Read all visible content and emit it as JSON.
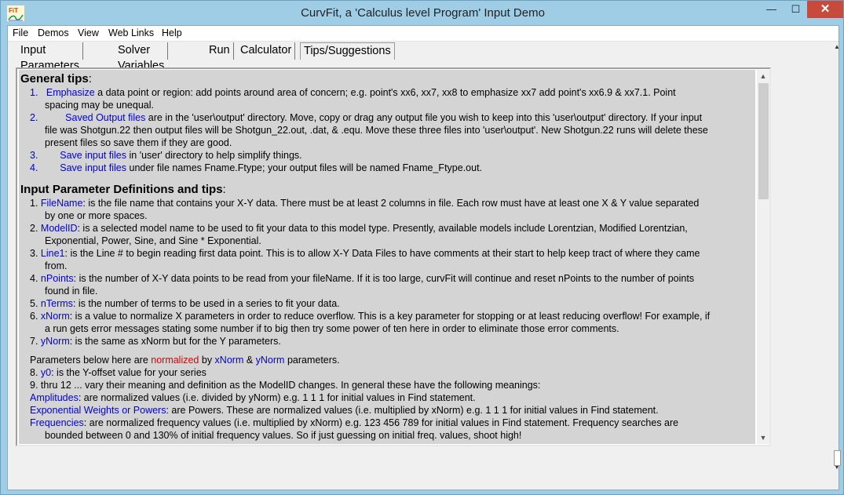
{
  "window": {
    "title": "CurvFit, a 'Calculus level Program' Input Demo",
    "min_glyph": "—",
    "max_glyph": "☐",
    "close_glyph": "✕",
    "icon": "fit-app-icon"
  },
  "menu": [
    "File",
    "Demos",
    "View",
    "Web Links",
    "Help"
  ],
  "tabs": [
    "Input Parameters",
    "Solver Variables",
    "Run",
    "Calculator",
    "Tips/Suggestions"
  ],
  "active_tab": 4,
  "general_tips": {
    "heading": "General tips",
    "items": [
      {
        "num": "1.",
        "link": "Emphasize",
        "line1": " a data point or region: add points around area of concern; e.g. point's xx6, xx7, xx8 to emphasize xx7 add point's xx6.9 & xx7.1.  Point",
        "line2": "spacing may be unequal."
      },
      {
        "num": "2.",
        "link": "Saved Output files",
        "line1": " are in the 'user\\output' directory.  Move, copy or drag any output file you wish to keep into this 'user\\output' directory.  If your input",
        "line2": "file was Shotgun.22 then output files will be Shotgun_22.out, .dat, & .equ.  Move these three files into 'user\\output'.  New Shotgun.22 runs will delete these",
        "line3": "present files so save them if they are good."
      },
      {
        "num": "3.",
        "link": "Save input files",
        "line1": " in 'user' directory to help simplify things."
      },
      {
        "num": "4.",
        "link": "Save input files",
        "line1": " under file names Fname.Ftype; your output files will be named Fname_Ftype.out."
      }
    ]
  },
  "input_defs": {
    "heading": "Input Parameter Definitions and tips",
    "items": [
      {
        "num": "1.",
        "link": "FileName",
        "line1": ": is the file name that contains your X-Y data. There must be at least 2 columns in file.  Each row must have at least one X & Y value separated",
        "line2": "by one or more spaces."
      },
      {
        "num": "2.",
        "link": "ModelID",
        "line1": ": is a selected model name to be used to fit your data to this model type.  Presently, available models include Lorentzian, Modified Lorentzian,",
        "line2": "Exponential, Power, Sine, and Sine * Exponential."
      },
      {
        "num": "3.",
        "link": "Line1",
        "line1": ": is the Line # to begin reading first data point.  This is to allow X-Y Data Files to have comments at their start to help keep tract of where they came",
        "line2": "from."
      },
      {
        "num": "4.",
        "link": "nPoints",
        "line1": ": is the number of X-Y data points to be read from your fileName.  If it is too large, curvFit will continue and reset nPoints to the number of points",
        "line2": "found in file."
      },
      {
        "num": "5.",
        "link": "nTerms",
        "line1": ": is the number of terms to be used in a series to fit your data."
      },
      {
        "num": "6.",
        "link": "xNorm",
        "line1": ": is a value to normalize X parameters in order to reduce overflow.  This is a key parameter for stopping or at least reducing overflow!  For example, if",
        "line2": "a run gets error messages stating some number if to big then try some power of ten here in order to eliminate those error comments."
      },
      {
        "num": "7.",
        "link": "yNorm",
        "line1": ": is the same as xNorm but for the Y parameters."
      }
    ]
  },
  "normalized": {
    "pre": "Parameters below here are ",
    "red": "normalized",
    "mid1": " by ",
    "b1": "xNorm",
    "mid2": " & ",
    "b2": "yNorm",
    "post": " parameters.",
    "l8_num": "8. ",
    "l8_link": "y0",
    "l8_text": ": is the Y-offset value for your series",
    "l9": "9. thru 12 ... vary their meaning and definition as the ModelID changes. In general these have the following meanings:",
    "amp_link": "Amplitudes",
    "amp_text": ": are normalized values (i.e. divided by yNorm) e.g. 1 1 1 for initial values in Find statement.",
    "exp_link": "Exponential Weights or Powers",
    "exp_text": ": are Powers. These are normalized values (i.e. multiplied by xNorm) e.g. 1 1 1 for initial values in Find statement.",
    "freq_link": "Frequencies",
    "freq_text": ": are normalized frequency values (i.e. multiplied by xNorm) e.g. 123 456 789 for initial values in Find statement. Frequency searches are",
    "freq_text2": "bounded between 0 and 130% of initial frequency values.  So if just guessing on initial freq. values, shoot high!"
  },
  "scroll": {
    "up": "▲",
    "down": "▼"
  }
}
